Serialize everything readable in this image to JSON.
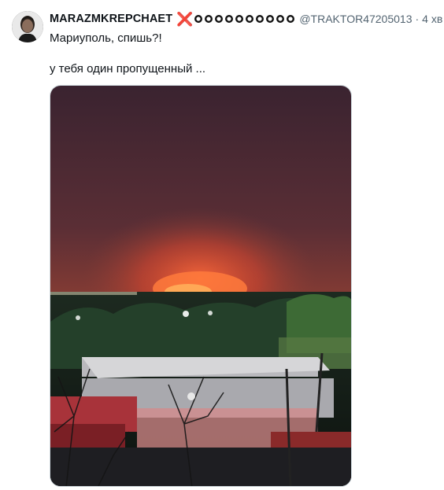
{
  "tweet": {
    "author_name": "MARAZMKREPCHAET",
    "cross_symbol": "❌",
    "handle": "@TRAKTOR47205013",
    "separator": "·",
    "timestamp": "4 хв",
    "text_line1": "Мариуполь, спишь?!",
    "text_line2": "у тебя один пропущенный ...",
    "badge_count": 10
  },
  "colors": {
    "accent_cross": "#d8232a",
    "secondary_text": "#536471"
  },
  "icons": {
    "cross": "cross-mark-icon",
    "badge": "ring-badge-icon"
  }
}
